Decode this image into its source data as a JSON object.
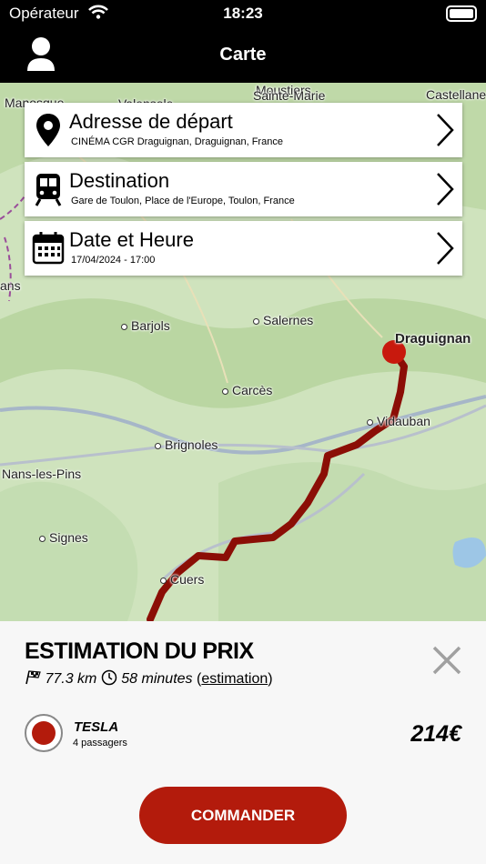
{
  "status_bar": {
    "carrier": "Opérateur",
    "time": "18:23"
  },
  "navbar": {
    "title": "Carte",
    "user_icon": "user-icon"
  },
  "colors": {
    "accent": "#b31b0c",
    "navbar": "#000000",
    "panel": "#f7f7f7"
  },
  "map": {
    "places": {
      "valensole": "Valensole",
      "moustiers": "Moustiers",
      "sainte_marie": "Sainte-Marie",
      "castellane": "Castellane",
      "manosque": "Manosque",
      "ans": "ans",
      "barjols": "Barjols",
      "salernes": "Salernes",
      "draguignan": "Draguignan",
      "carces": "Carcès",
      "vidauban": "Vidauban",
      "brignoles": "Brignoles",
      "nans": "Nans-les-Pins",
      "signes": "Signes",
      "cuers": "Cuers"
    }
  },
  "cards": [
    {
      "title": "Adresse de départ",
      "subtitle": "CINÉMA CGR Draguignan, Draguignan, France",
      "icon": "map-pin-icon"
    },
    {
      "title": "Destination",
      "subtitle": "Gare de Toulon, Place de l'Europe, Toulon, France",
      "icon": "train-icon"
    },
    {
      "title": "Date et Heure",
      "subtitle": "17/04/2024 - 17:00",
      "icon": "calendar-icon"
    }
  ],
  "estimate": {
    "title": "ESTIMATION DU PRIX",
    "distance": "77.3 km",
    "duration": "58 minutes",
    "paren_open": "(",
    "link": "estimation",
    "paren_close": ")"
  },
  "vehicle": {
    "name": "TESLA",
    "seats": "4 passagers",
    "price": "214€"
  },
  "order_button": "COMMANDER"
}
